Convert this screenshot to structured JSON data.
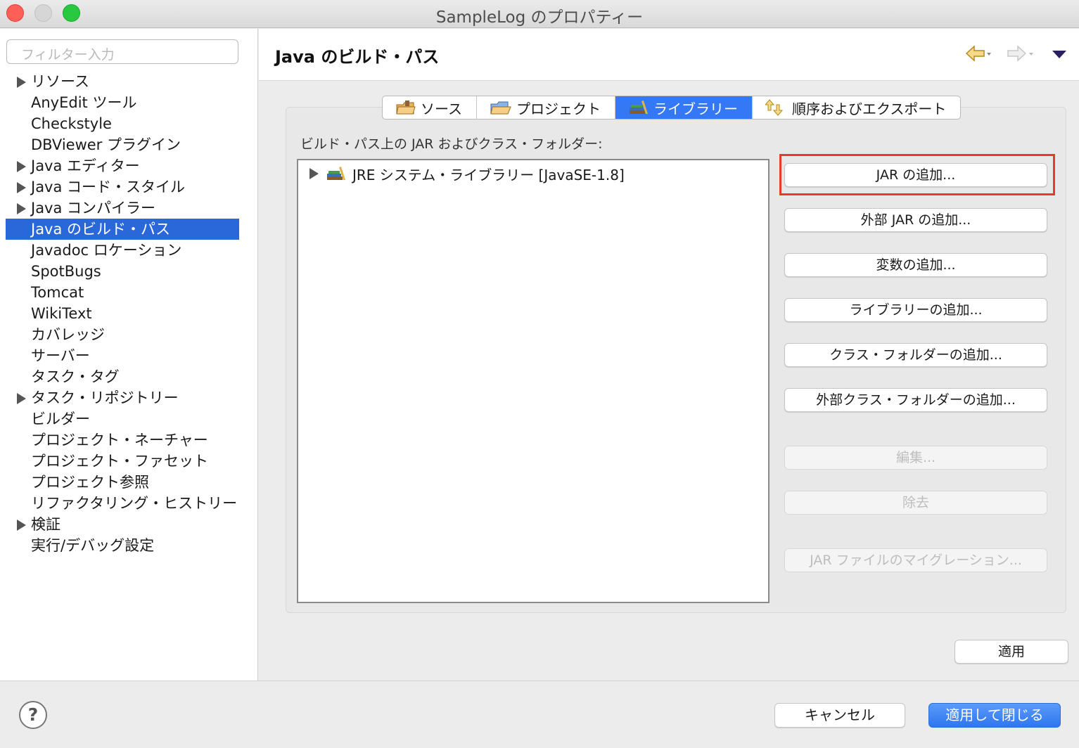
{
  "window": {
    "title": "SampleLog のプロパティー"
  },
  "filter": {
    "placeholder": "フィルター入力"
  },
  "tree": {
    "items": [
      {
        "label": "リソース",
        "expandable": true,
        "selected": false
      },
      {
        "label": "AnyEdit ツール",
        "expandable": false,
        "selected": false
      },
      {
        "label": "Checkstyle",
        "expandable": false,
        "selected": false
      },
      {
        "label": "DBViewer プラグイン",
        "expandable": false,
        "selected": false
      },
      {
        "label": "Java エディター",
        "expandable": true,
        "selected": false
      },
      {
        "label": "Java コード・スタイル",
        "expandable": true,
        "selected": false
      },
      {
        "label": "Java コンパイラー",
        "expandable": true,
        "selected": false
      },
      {
        "label": "Java のビルド・パス",
        "expandable": false,
        "selected": true
      },
      {
        "label": "Javadoc ロケーション",
        "expandable": false,
        "selected": false
      },
      {
        "label": "SpotBugs",
        "expandable": false,
        "selected": false
      },
      {
        "label": "Tomcat",
        "expandable": false,
        "selected": false
      },
      {
        "label": "WikiText",
        "expandable": false,
        "selected": false
      },
      {
        "label": "カバレッジ",
        "expandable": false,
        "selected": false
      },
      {
        "label": "サーバー",
        "expandable": false,
        "selected": false
      },
      {
        "label": "タスク・タグ",
        "expandable": false,
        "selected": false
      },
      {
        "label": "タスク・リポジトリー",
        "expandable": true,
        "selected": false
      },
      {
        "label": "ビルダー",
        "expandable": false,
        "selected": false
      },
      {
        "label": "プロジェクト・ネーチャー",
        "expandable": false,
        "selected": false
      },
      {
        "label": "プロジェクト・ファセット",
        "expandable": false,
        "selected": false
      },
      {
        "label": "プロジェクト参照",
        "expandable": false,
        "selected": false
      },
      {
        "label": "リファクタリング・ヒストリー",
        "expandable": false,
        "selected": false
      },
      {
        "label": "検証",
        "expandable": true,
        "selected": false
      },
      {
        "label": "実行/デバッグ設定",
        "expandable": false,
        "selected": false
      }
    ]
  },
  "main": {
    "title": "Java のビルド・パス",
    "tabs": [
      {
        "label": "ソース",
        "icon": "source-folder-icon",
        "active": false
      },
      {
        "label": "プロジェクト",
        "icon": "project-folder-icon",
        "active": false
      },
      {
        "label": "ライブラリー",
        "icon": "library-icon",
        "active": true
      },
      {
        "label": "順序およびエクスポート",
        "icon": "order-export-icon",
        "active": false
      }
    ],
    "list_label": "ビルド・パス上の JAR およびクラス・フォルダー:",
    "entries": [
      {
        "label": "JRE システム・ライブラリー [JavaSE-1.8]",
        "icon": "jre-library-icon"
      }
    ],
    "buttons": [
      {
        "label": "JAR の追加...",
        "enabled": true,
        "highlighted": true
      },
      {
        "label": "外部 JAR の追加...",
        "enabled": true
      },
      {
        "label": "変数の追加...",
        "enabled": true
      },
      {
        "label": "ライブラリーの追加...",
        "enabled": true
      },
      {
        "label": "クラス・フォルダーの追加...",
        "enabled": true
      },
      {
        "label": "外部クラス・フォルダーの追加...",
        "enabled": true
      },
      {
        "label": "編集...",
        "enabled": false
      },
      {
        "label": "除去",
        "enabled": false
      },
      {
        "label": "JAR ファイルのマイグレーション...",
        "enabled": false
      }
    ],
    "apply_label": "適用"
  },
  "footer": {
    "help_label": "?",
    "cancel_label": "キャンセル",
    "ok_label": "適用して閉じる"
  },
  "colors": {
    "selection": "#2a67d8",
    "highlight_border": "#e53b2c",
    "primary_button": "#3478f6"
  }
}
